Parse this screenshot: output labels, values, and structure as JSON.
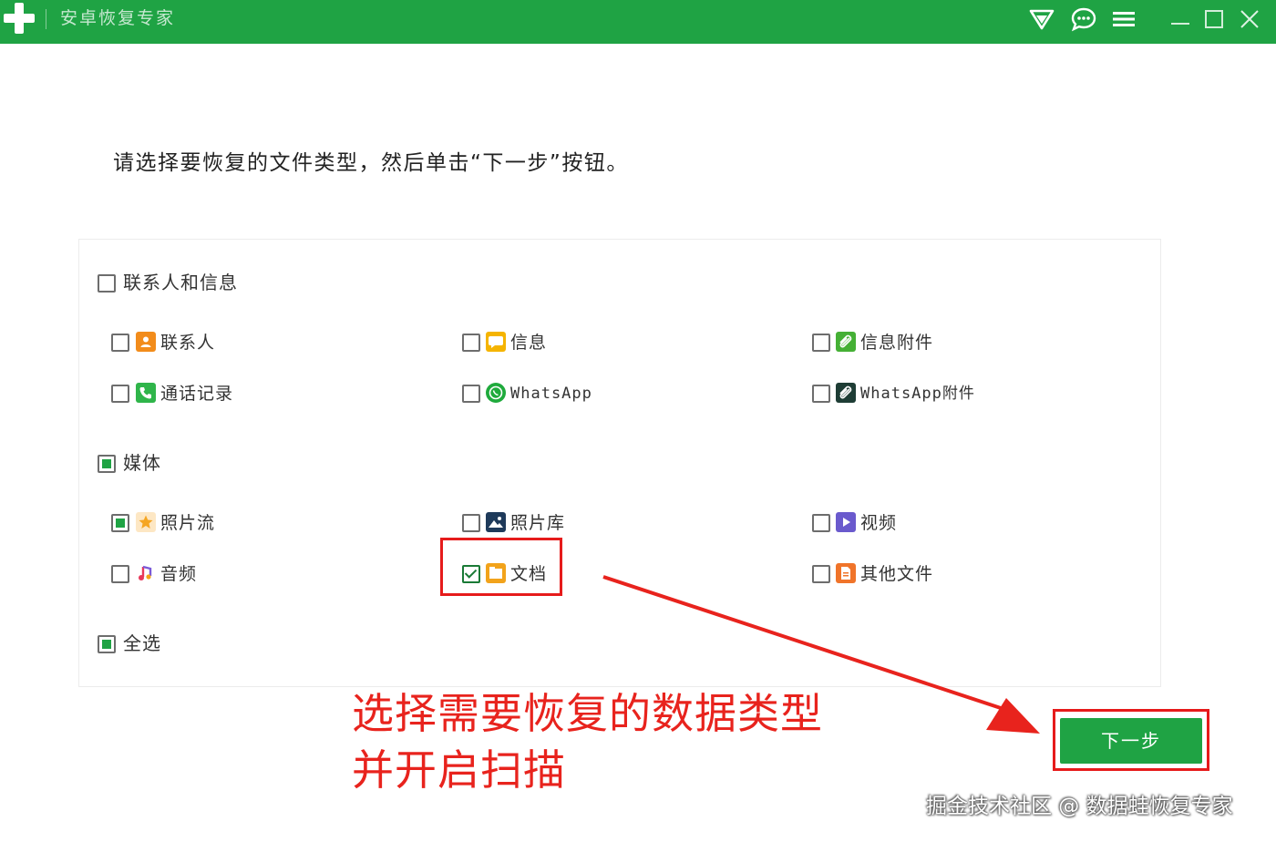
{
  "window": {
    "title": "安卓恢复专家"
  },
  "colors": {
    "brand_green": "#1fa344",
    "annotation_red": "#e8231d"
  },
  "titlebar": {
    "icons": [
      "shield-icon",
      "chat-icon",
      "menu-icon",
      "minimize-icon",
      "maximize-icon",
      "close-icon"
    ]
  },
  "instruction": "请选择要恢复的文件类型，然后单击“下一步”按钮。",
  "groups": {
    "contacts_messages": {
      "label": "联系人和信息",
      "state": "unchecked",
      "items": [
        {
          "label": "联系人",
          "icon": "contact-icon",
          "checked": false
        },
        {
          "label": "信息",
          "icon": "message-icon",
          "checked": false
        },
        {
          "label": "信息附件",
          "icon": "attachment-icon",
          "checked": false
        },
        {
          "label": "通话记录",
          "icon": "phone-icon",
          "checked": false
        },
        {
          "label": "WhatsApp",
          "icon": "whatsapp-icon",
          "checked": false
        },
        {
          "label": "WhatsApp附件",
          "icon": "whatsapp-attachment-icon",
          "checked": false
        }
      ]
    },
    "media": {
      "label": "媒体",
      "state": "partial",
      "items": [
        {
          "label": "照片流",
          "icon": "photostream-icon",
          "checked": "partial"
        },
        {
          "label": "照片库",
          "icon": "gallery-icon",
          "checked": false
        },
        {
          "label": "视频",
          "icon": "video-icon",
          "checked": false
        },
        {
          "label": "音频",
          "icon": "audio-icon",
          "checked": false
        },
        {
          "label": "文档",
          "icon": "document-icon",
          "checked": true
        },
        {
          "label": "其他文件",
          "icon": "file-icon",
          "checked": false
        }
      ]
    },
    "select_all": {
      "label": "全选",
      "state": "partial"
    }
  },
  "annotation": {
    "line1": "选择需要恢复的数据类型",
    "line2": "并开启扫描"
  },
  "next_button": {
    "label": "下一步"
  },
  "watermark": "掘金技术社区 @ 数据蛙恢复专家"
}
